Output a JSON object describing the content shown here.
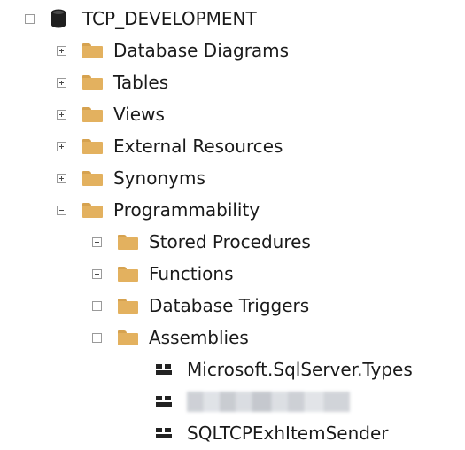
{
  "tree": {
    "root": {
      "label": "TCP_DEVELOPMENT",
      "expanded": true,
      "icon": "database-icon"
    },
    "top_folders": [
      {
        "label": "Database Diagrams",
        "expanded": false,
        "icon": "folder-icon"
      },
      {
        "label": "Tables",
        "expanded": false,
        "icon": "folder-icon"
      },
      {
        "label": "Views",
        "expanded": false,
        "icon": "folder-icon"
      },
      {
        "label": "External Resources",
        "expanded": false,
        "icon": "folder-icon"
      },
      {
        "label": "Synonyms",
        "expanded": false,
        "icon": "folder-icon"
      },
      {
        "label": "Programmability",
        "expanded": true,
        "icon": "folder-icon"
      }
    ],
    "programmability_children": [
      {
        "label": "Stored Procedures",
        "expanded": false,
        "icon": "folder-icon"
      },
      {
        "label": "Functions",
        "expanded": false,
        "icon": "folder-icon"
      },
      {
        "label": "Database Triggers",
        "expanded": false,
        "icon": "folder-icon"
      },
      {
        "label": "Assemblies",
        "expanded": true,
        "icon": "folder-icon"
      }
    ],
    "assemblies": [
      {
        "label": "Microsoft.SqlServer.Types",
        "icon": "assembly-icon"
      },
      {
        "label": "",
        "icon": "assembly-icon",
        "redacted": true
      },
      {
        "label": "SQLTCPExhItemSender",
        "icon": "assembly-icon"
      }
    ]
  },
  "colors": {
    "folder": "#e3b15f",
    "toggle_border": "#9a9a9a",
    "text": "#1a1a1a",
    "background": "#ffffff"
  }
}
